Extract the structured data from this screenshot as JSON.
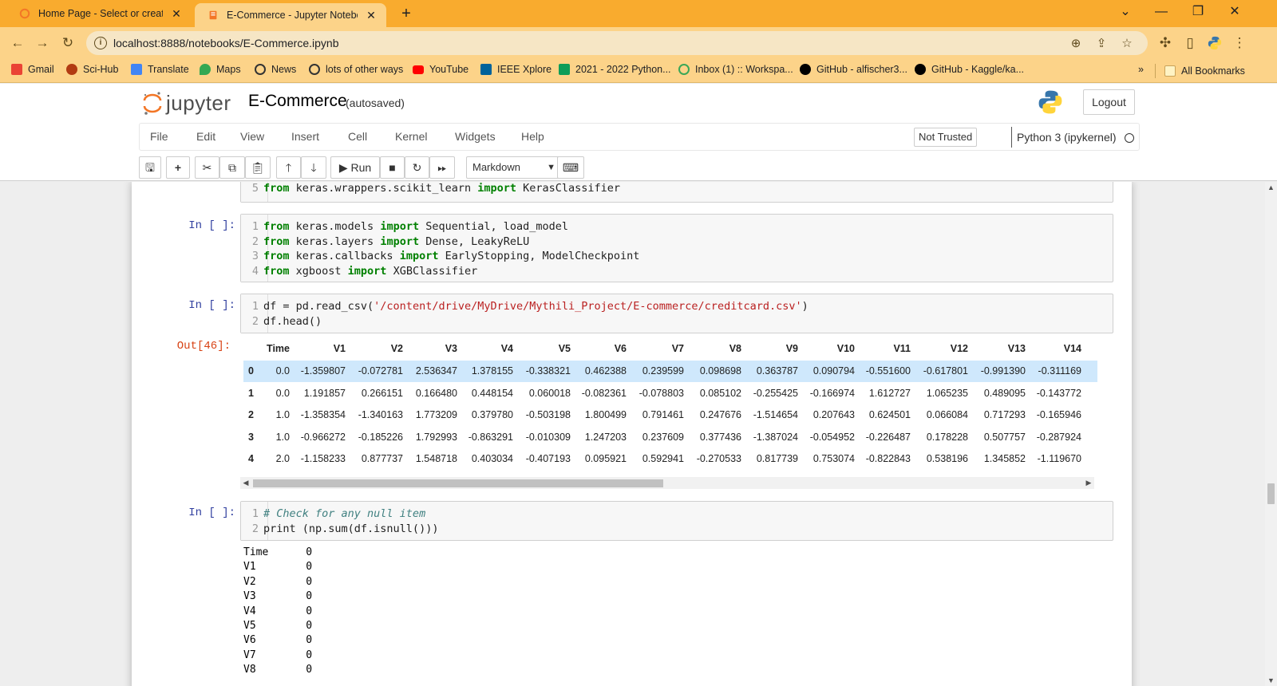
{
  "browser": {
    "tabs": [
      {
        "title": "Home Page - Select or create a n",
        "active": false
      },
      {
        "title": "E-Commerce - Jupyter Notebook",
        "active": true
      }
    ],
    "url": "localhost:8888/notebooks/E-Commerce.ipynb",
    "bookmarks": [
      {
        "label": "Gmail",
        "icon": "gmail-icon",
        "color": "#ea4335"
      },
      {
        "label": "Sci-Hub",
        "icon": "scihub-icon",
        "color": "#b23b12"
      },
      {
        "label": "Translate",
        "icon": "translate-icon",
        "color": "#4285f4"
      },
      {
        "label": "Maps",
        "icon": "maps-icon",
        "color": "#34a853"
      },
      {
        "label": "News",
        "icon": "globe-icon",
        "color": "#333333"
      },
      {
        "label": "lots of other ways",
        "icon": "globe-icon",
        "color": "#333333"
      },
      {
        "label": "YouTube",
        "icon": "youtube-icon",
        "color": "#ff0000"
      },
      {
        "label": "IEEE Xplore",
        "icon": "ieee-icon",
        "color": "#00629b"
      },
      {
        "label": "2021 - 2022 Python...",
        "icon": "sheets-icon",
        "color": "#0f9d58"
      },
      {
        "label": "Inbox (1) :: Workspa...",
        "icon": "workspace-icon",
        "color": "#3aa757"
      },
      {
        "label": "GitHub - alfischer3...",
        "icon": "github-icon",
        "color": "#000000"
      },
      {
        "label": "GitHub - Kaggle/ka...",
        "icon": "github-icon",
        "color": "#000000"
      }
    ],
    "all_bookmarks": "All Bookmarks",
    "overflow": "»"
  },
  "jupyter": {
    "logo_text": "jupyter",
    "notebook_name": "E-Commerce",
    "autosave": "(autosaved)",
    "logout": "Logout",
    "menu": [
      "File",
      "Edit",
      "View",
      "Insert",
      "Cell",
      "Kernel",
      "Widgets",
      "Help"
    ],
    "trust": "Not Trusted",
    "kernel": "Python 3 (ipykernel)",
    "run_label": "Run",
    "cell_type": "Markdown"
  },
  "cells": {
    "partial_line": {
      "num": "5",
      "code": "from keras.wrappers.scikit_learn import KerasClassifier"
    },
    "cell_a": {
      "prompt": "In [ ]:",
      "lines": [
        {
          "num": "1",
          "text": "from keras.models import Sequential, load_model"
        },
        {
          "num": "2",
          "text": "from keras.layers import Dense, LeakyReLU"
        },
        {
          "num": "3",
          "text": "from keras.callbacks import EarlyStopping, ModelCheckpoint"
        },
        {
          "num": "4",
          "text": "from xgboost import XGBClassifier"
        }
      ]
    },
    "cell_b": {
      "prompt": "In [ ]:",
      "out_prompt": "Out[46]:",
      "line1_num": "1",
      "line1_pre": "df = pd.read_csv(",
      "line1_str": "'/content/drive/MyDrive/Mythili_Project/E-commerce/creditcard.csv'",
      "line1_post": ")",
      "line2_num": "2",
      "line2": "df.head()"
    },
    "dataframe": {
      "columns": [
        "",
        "Time",
        "V1",
        "V2",
        "V3",
        "V4",
        "V5",
        "V6",
        "V7",
        "V8",
        "V9",
        "V10",
        "V11",
        "V12",
        "V13",
        "V14"
      ],
      "rows": [
        [
          "0",
          "0.0",
          "-1.359807",
          "-0.072781",
          "2.536347",
          "1.378155",
          "-0.338321",
          "0.462388",
          "0.239599",
          "0.098698",
          "0.363787",
          "0.090794",
          "-0.551600",
          "-0.617801",
          "-0.991390",
          "-0.311169"
        ],
        [
          "1",
          "0.0",
          "1.191857",
          "0.266151",
          "0.166480",
          "0.448154",
          "0.060018",
          "-0.082361",
          "-0.078803",
          "0.085102",
          "-0.255425",
          "-0.166974",
          "1.612727",
          "1.065235",
          "0.489095",
          "-0.143772"
        ],
        [
          "2",
          "1.0",
          "-1.358354",
          "-1.340163",
          "1.773209",
          "0.379780",
          "-0.503198",
          "1.800499",
          "0.791461",
          "0.247676",
          "-1.514654",
          "0.207643",
          "0.624501",
          "0.066084",
          "0.717293",
          "-0.165946"
        ],
        [
          "3",
          "1.0",
          "-0.966272",
          "-0.185226",
          "1.792993",
          "-0.863291",
          "-0.010309",
          "1.247203",
          "0.237609",
          "0.377436",
          "-1.387024",
          "-0.054952",
          "-0.226487",
          "0.178228",
          "0.507757",
          "-0.287924"
        ],
        [
          "4",
          "2.0",
          "-1.158233",
          "0.877737",
          "1.548718",
          "0.403034",
          "-0.407193",
          "0.095921",
          "0.592941",
          "-0.270533",
          "0.817739",
          "0.753074",
          "-0.822843",
          "0.538196",
          "1.345852",
          "-1.119670"
        ]
      ]
    },
    "cell_c": {
      "prompt": "In [ ]:",
      "line1_num": "1",
      "line1": "# Check for any null item",
      "line2_num": "2",
      "line2": "print (np.sum(df.isnull()))"
    },
    "null_output": "Time      0\nV1        0\nV2        0\nV3        0\nV4        0\nV5        0\nV6        0\nV7        0\nV8        0"
  }
}
